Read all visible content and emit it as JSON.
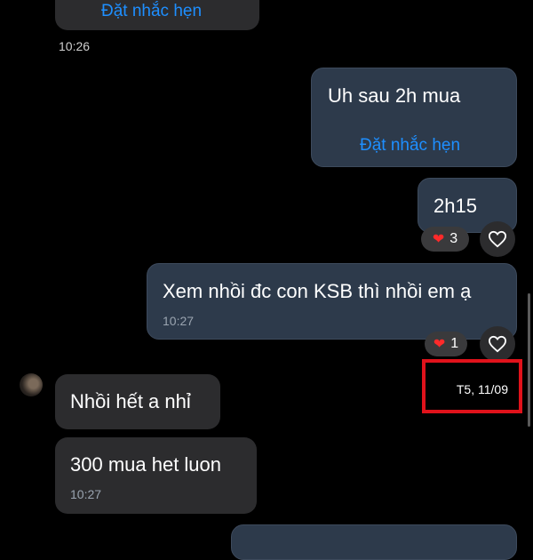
{
  "messages": [
    {
      "id": "m0",
      "side": "in",
      "link": "Đặt nhắc hẹn"
    },
    {
      "id": "m0time",
      "time": "10:26"
    },
    {
      "id": "m1",
      "side": "out",
      "text": "Uh sau 2h mua",
      "link": "Đặt nhắc hẹn"
    },
    {
      "id": "m2",
      "side": "out",
      "text": "2h15",
      "reaction": {
        "emoji": "❤️",
        "count": "3"
      }
    },
    {
      "id": "m3",
      "side": "out",
      "text": "Xem nhồi đc con KSB thì nhồi em ạ",
      "time": "10:27",
      "reaction": {
        "emoji": "❤️",
        "count": "1"
      }
    },
    {
      "id": "m4",
      "side": "in",
      "text": "Nhồi hết a nhỉ"
    },
    {
      "id": "m5",
      "side": "in",
      "text": "300 mua het luon",
      "time": "10:27"
    }
  ],
  "date_separator": "T5, 11/09",
  "colors": {
    "background": "#000000",
    "incoming": "#2c2c2e",
    "outgoing": "#2d3a4b",
    "link": "#1e8fff",
    "highlight": "#e0121b"
  },
  "icons": {
    "heart_outline": "heart-outline-icon",
    "heart_red": "red-heart-icon",
    "avatar": "avatar"
  }
}
